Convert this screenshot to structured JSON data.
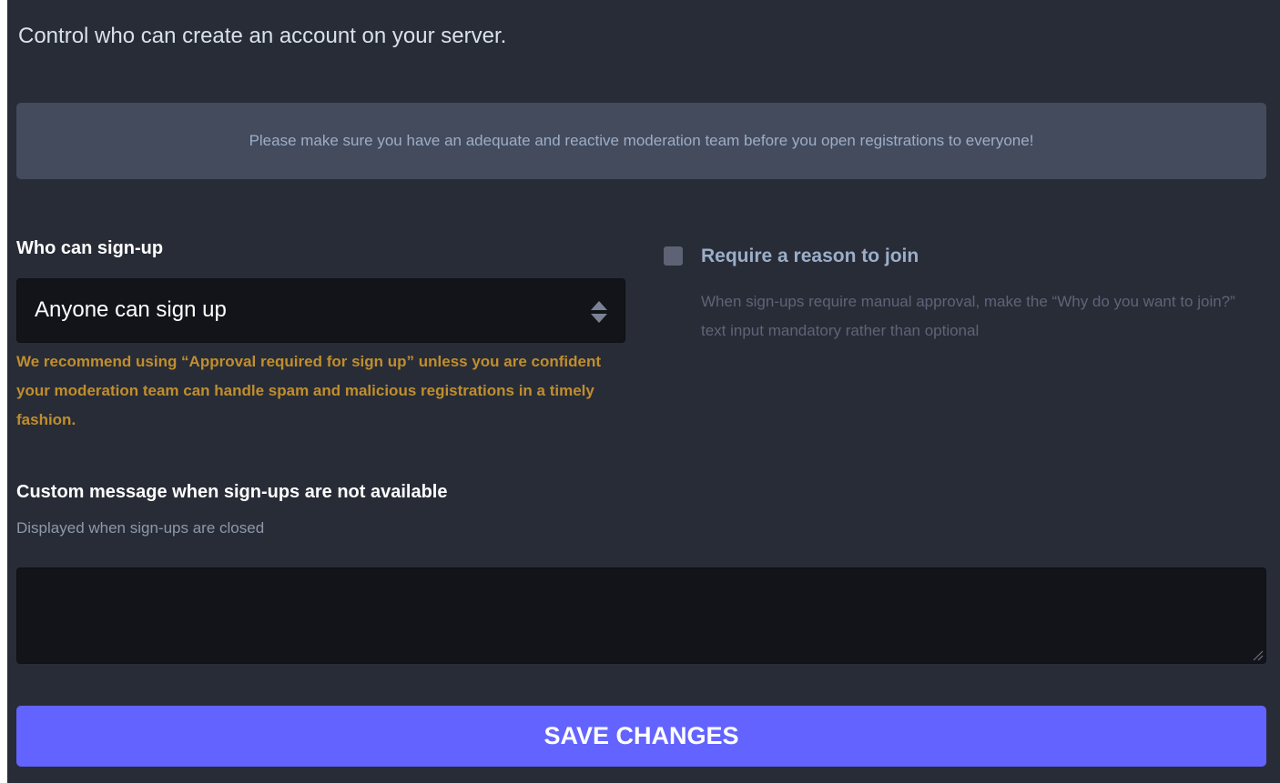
{
  "intro_text": "Control who can create an account on your server.",
  "warning_notice": "Please make sure you have an adequate and reactive moderation team before you open registrations to everyone!",
  "signup": {
    "label": "Who can sign-up",
    "selected_option": "Anyone can sign up",
    "recommendation": "We recommend using “Approval required for sign up” unless you are confident your moderation team can handle spam and malicious registrations in a timely fashion."
  },
  "require_reason": {
    "label": "Require a reason to join",
    "checked": false,
    "hint": "When sign-ups require manual approval, make the “Why do you want to join?” text input mandatory rather than optional"
  },
  "closed_message": {
    "label": "Custom message when sign-ups are not available",
    "hint": "Displayed when sign-ups are closed",
    "value": ""
  },
  "save_button_label": "SAVE CHANGES",
  "icons": {
    "select_arrows": "sort-icon",
    "textarea_resize": "resize-handle-icon"
  },
  "colors": {
    "background": "#282c37",
    "notice_background": "#444b5d",
    "input_background": "#131419",
    "warning_text": "#c08e2c",
    "primary_button": "#6364ff"
  }
}
